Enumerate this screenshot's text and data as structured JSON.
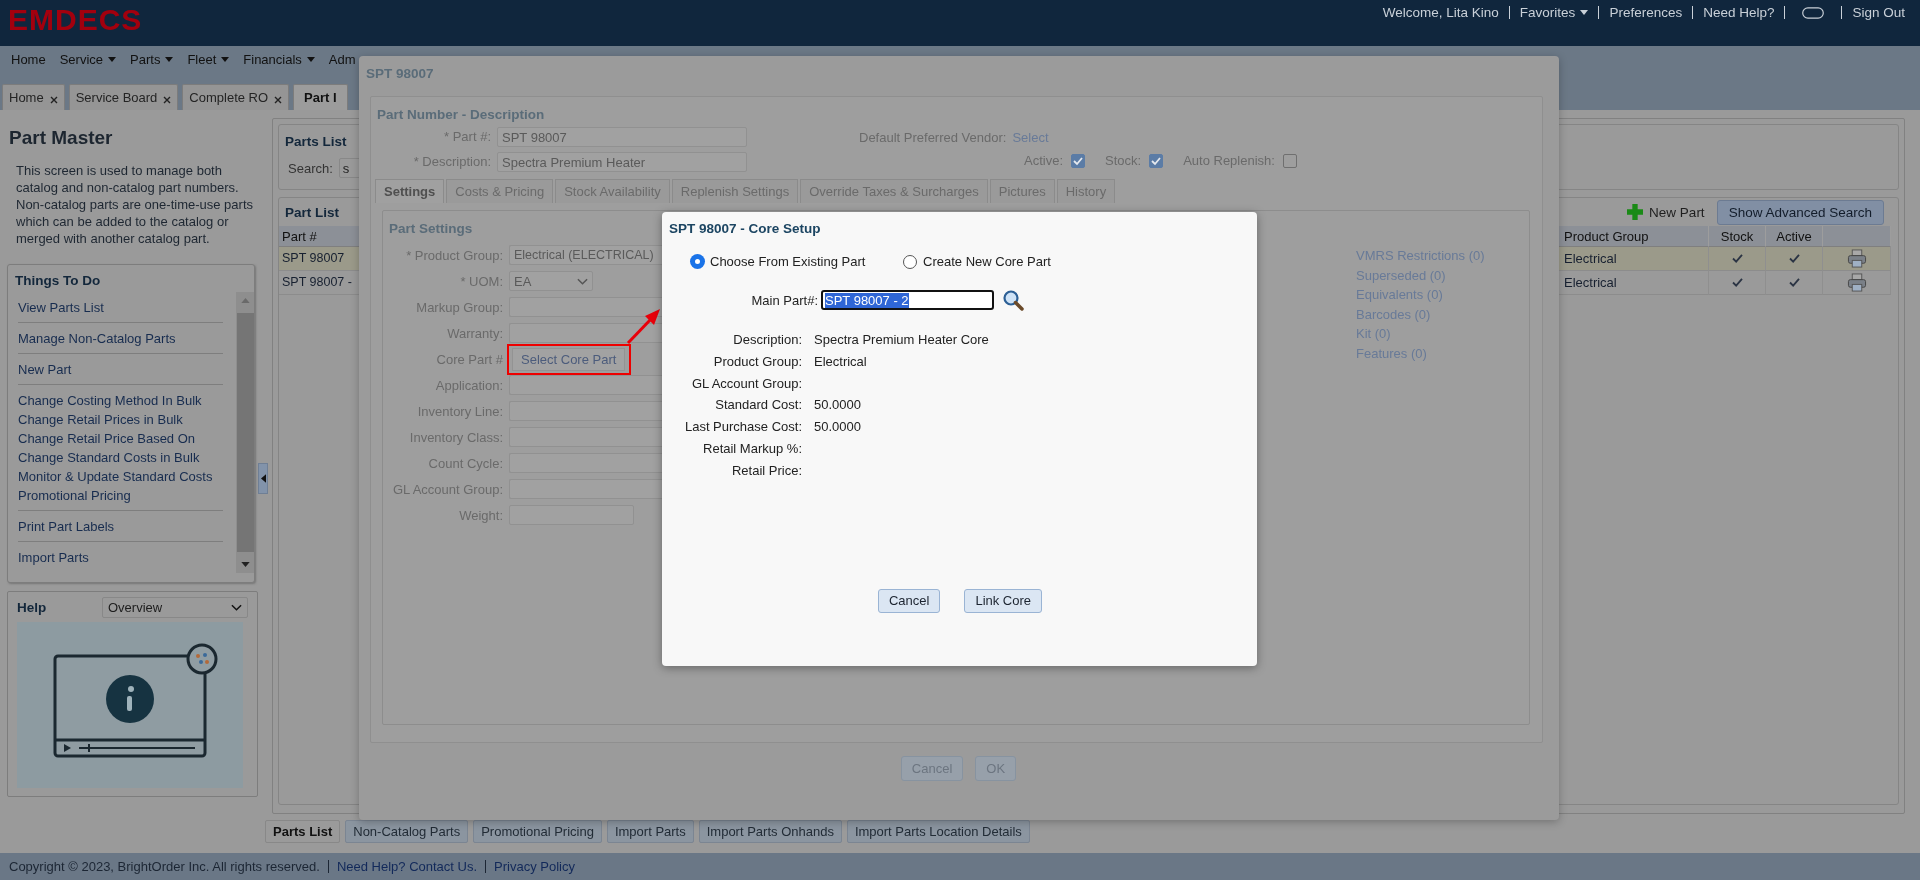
{
  "header": {
    "logo": "EMDECS",
    "links": [
      {
        "label": "Welcome, Lita Kino",
        "kind": "text"
      },
      {
        "label": "Favorites",
        "kind": "dropdown"
      },
      {
        "label": "Preferences",
        "kind": "link"
      },
      {
        "label": "Need Help?",
        "kind": "link"
      },
      {
        "kind": "icon"
      },
      {
        "label": "Sign Out",
        "kind": "link"
      }
    ]
  },
  "nav": [
    {
      "label": "Home",
      "menu": false
    },
    {
      "label": "Service",
      "menu": true
    },
    {
      "label": "Parts",
      "menu": true
    },
    {
      "label": "Fleet",
      "menu": true
    },
    {
      "label": "Financials",
      "menu": true
    },
    {
      "label": "Adm",
      "menu": false
    }
  ],
  "page_tabs": [
    {
      "label": "Home",
      "closable": true,
      "selected": false
    },
    {
      "label": "Service Board",
      "closable": true,
      "selected": false
    },
    {
      "label": "Complete RO",
      "closable": true,
      "selected": false
    },
    {
      "label": "Part I",
      "closable": false,
      "selected": true
    }
  ],
  "sidebar": {
    "title": "Part Master",
    "description": "This screen is used to manage both catalog and non-catalog part numbers. Non-catalog parts are one-time-use parts which can be added to the catalog or merged with another catalog part.",
    "things_to_do": {
      "title": "Things To Do",
      "groups": [
        [
          "View Parts List"
        ],
        [
          "Manage Non-Catalog Parts"
        ],
        [
          "New Part"
        ],
        [
          "Change Costing Method In Bulk",
          "Change Retail Prices in Bulk",
          "Change Retail Price Based On",
          "Change Standard Costs in Bulk",
          "Monitor & Update Standard Costs",
          "Promotional Pricing"
        ],
        [
          "Print Part Labels"
        ],
        [
          "Import Parts"
        ]
      ]
    },
    "help": {
      "title": "Help",
      "topic": "Overview"
    }
  },
  "parts_list": {
    "title": "Parts List",
    "search_label": "Search:",
    "search_value": "s"
  },
  "part_list": {
    "title": "Part List",
    "new_part": "New Part",
    "advanced_search": "Show Advanced Search",
    "columns": [
      "Part #",
      "Product Group",
      "Stock",
      "Active"
    ],
    "rows": [
      {
        "part": "SPT 98007",
        "product_group": "Electrical",
        "stock": true,
        "active": true,
        "selected": true
      },
      {
        "part": "SPT 98007 -",
        "product_group": "Electrical",
        "stock": true,
        "active": true,
        "selected": false
      }
    ]
  },
  "bottom_tabs": [
    {
      "label": "Parts List",
      "selected": true
    },
    {
      "label": "Non-Catalog Parts",
      "selected": false
    },
    {
      "label": "Promotional Pricing",
      "selected": false
    },
    {
      "label": "Import Parts",
      "selected": false
    },
    {
      "label": "Import Parts Onhands",
      "selected": false
    },
    {
      "label": "Import Parts Location Details",
      "selected": false
    }
  ],
  "footer": {
    "copyright": "Copyright © 2023, BrightOrder Inc. All rights reserved.",
    "links": [
      "Need Help? Contact Us.",
      "Privacy Policy"
    ]
  },
  "part_dialog": {
    "title": "SPT 98007",
    "section": "Part Number - Description",
    "part_label": "* Part #:",
    "part_value": "SPT 98007",
    "description_label": "* Description:",
    "description_value": "Spectra Premium Heater",
    "vendor_label": "Default Preferred Vendor:",
    "vendor_link": "Select",
    "flags": [
      {
        "label": "Active:",
        "checked": true
      },
      {
        "label": "Stock:",
        "checked": true
      },
      {
        "label": "Auto Replenish:",
        "checked": false
      }
    ],
    "tabs": [
      {
        "label": "Settings",
        "selected": true
      },
      {
        "label": "Costs & Pricing",
        "selected": false
      },
      {
        "label": "Stock Availability",
        "selected": false
      },
      {
        "label": "Replenish Settings",
        "selected": false
      },
      {
        "label": "Override Taxes & Surcharges",
        "selected": false
      },
      {
        "label": "Pictures",
        "selected": false
      },
      {
        "label": "History",
        "selected": false
      }
    ],
    "settings_title": "Part Settings",
    "fields": [
      {
        "label": "* Product Group:",
        "kind": "text",
        "value": "Electrical (ELECTRICAL)"
      },
      {
        "label": "* UOM:",
        "kind": "select",
        "value": "EA"
      },
      {
        "label": "Markup Group:",
        "kind": "text"
      },
      {
        "label": "Warranty:",
        "kind": "text"
      },
      {
        "label": "Core Part #",
        "kind": "button",
        "value": "Select Core Part"
      },
      {
        "label": "Application:",
        "kind": "text"
      },
      {
        "label": "Inventory Line:",
        "kind": "text"
      },
      {
        "label": "Inventory Class:",
        "kind": "text"
      },
      {
        "label": "Count Cycle:",
        "kind": "text"
      },
      {
        "label": "GL Account Group:",
        "kind": "text"
      },
      {
        "label": "Weight:",
        "kind": "short"
      }
    ],
    "links": [
      "VMRS Restrictions (0)",
      "Superseded (0)",
      "Equivalents (0)",
      "Barcodes (0)",
      "Kit (0)",
      "Features (0)"
    ],
    "buttons": [
      "Cancel",
      "OK"
    ]
  },
  "core_dialog": {
    "title": "SPT 98007 - Core Setup",
    "options": [
      {
        "label": "Choose From Existing Part",
        "selected": true
      },
      {
        "label": "Create New Core Part",
        "selected": false
      }
    ],
    "main_part_label": "Main Part#:",
    "main_part_value": "SPT 98007 - 2",
    "details": [
      {
        "label": "Description:",
        "value": "Spectra Premium Heater Core"
      },
      {
        "label": "Product Group:",
        "value": "Electrical"
      },
      {
        "label": "GL Account Group:"
      },
      {
        "label": "Standard Cost:",
        "value": "50.0000"
      },
      {
        "label": "Last Purchase Cost:",
        "value": "50.0000"
      },
      {
        "label": "Retail Markup %:"
      },
      {
        "label": "Retail Price:"
      }
    ],
    "buttons": [
      "Cancel",
      "Link Core"
    ]
  }
}
